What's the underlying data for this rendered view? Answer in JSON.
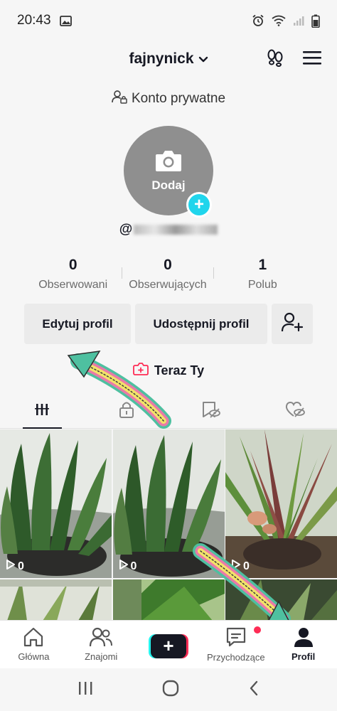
{
  "status_bar": {
    "time": "20:43"
  },
  "header": {
    "username": "fajnynick"
  },
  "profile": {
    "private_label": "Konto prywatne",
    "avatar_label": "Dodaj",
    "handle_prefix": "@"
  },
  "stats": [
    {
      "value": "0",
      "label": "Obserwowani"
    },
    {
      "value": "0",
      "label": "Obserwujących"
    },
    {
      "value": "1",
      "label": "Polub"
    }
  ],
  "actions": {
    "edit_label": "Edytuj profil",
    "share_label": "Udostępnij profil"
  },
  "teraz": {
    "label": "Teraz Ty"
  },
  "tabs": [
    {
      "icon": "grid-icon",
      "active": true
    },
    {
      "icon": "lock-icon",
      "active": false
    },
    {
      "icon": "hidden-bookmark-icon",
      "active": false
    },
    {
      "icon": "liked-hidden-icon",
      "active": false
    }
  ],
  "videos": [
    {
      "views": "0"
    },
    {
      "views": "0"
    },
    {
      "views": "0"
    }
  ],
  "bottom_nav": [
    {
      "label": "Główna",
      "icon": "home-icon"
    },
    {
      "label": "Znajomi",
      "icon": "friends-icon"
    },
    {
      "label": "",
      "icon": "create-icon"
    },
    {
      "label": "Przychodzące",
      "icon": "inbox-icon"
    },
    {
      "label": "Profil",
      "icon": "profile-icon"
    }
  ],
  "colors": {
    "accent_cyan": "#20d5ec",
    "accent_pink": "#fe2c55",
    "text_dark": "#161823"
  }
}
